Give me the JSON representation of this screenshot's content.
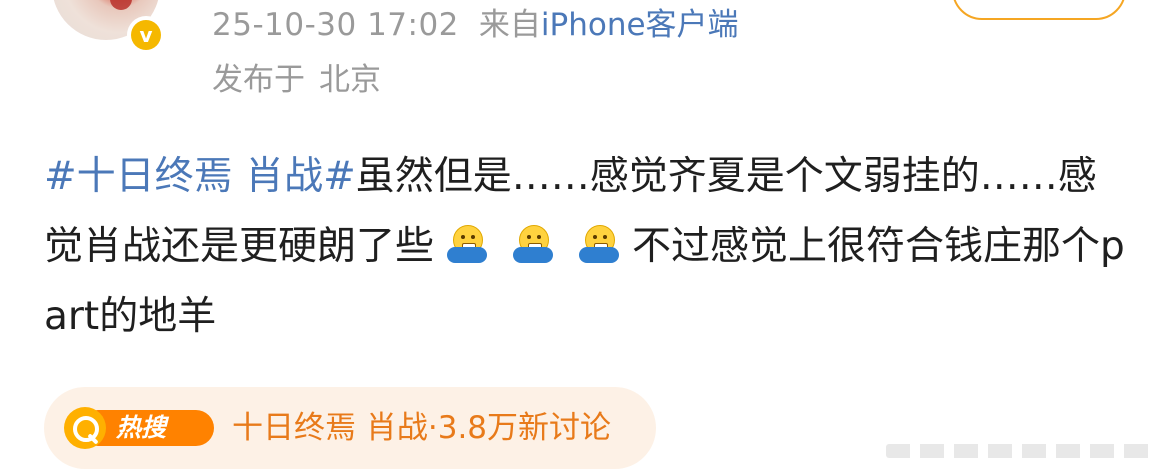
{
  "header": {
    "timestamp": "25-10-30 17:02",
    "from_prefix": "来自",
    "device": "iPhone客户端",
    "location_prefix": "发布于",
    "location": "北京",
    "verified_mark": "v"
  },
  "post": {
    "topic": "#十日终焉 肖战#",
    "text_part1": "虽然但是……感觉齐夏是个文弱挂的……感觉肖战还是更硬朗了些",
    "text_part2": "不过感觉上很符合钱庄那个part的地羊",
    "emojis": [
      "hand-over-mouth-emoji",
      "hand-over-mouth-emoji",
      "hand-over-mouth-emoji"
    ]
  },
  "hot_search": {
    "badge_label": "热搜",
    "topic": "十日终焉 肖战",
    "separator": "·",
    "discussion_count": "3.8万新讨论"
  },
  "colors": {
    "link_blue": "#4b78b8",
    "meta_gray": "#9a9a9a",
    "hot_orange": "#ff8200",
    "chip_bg": "#fdf1e6",
    "verify_gold": "#f5b800"
  }
}
